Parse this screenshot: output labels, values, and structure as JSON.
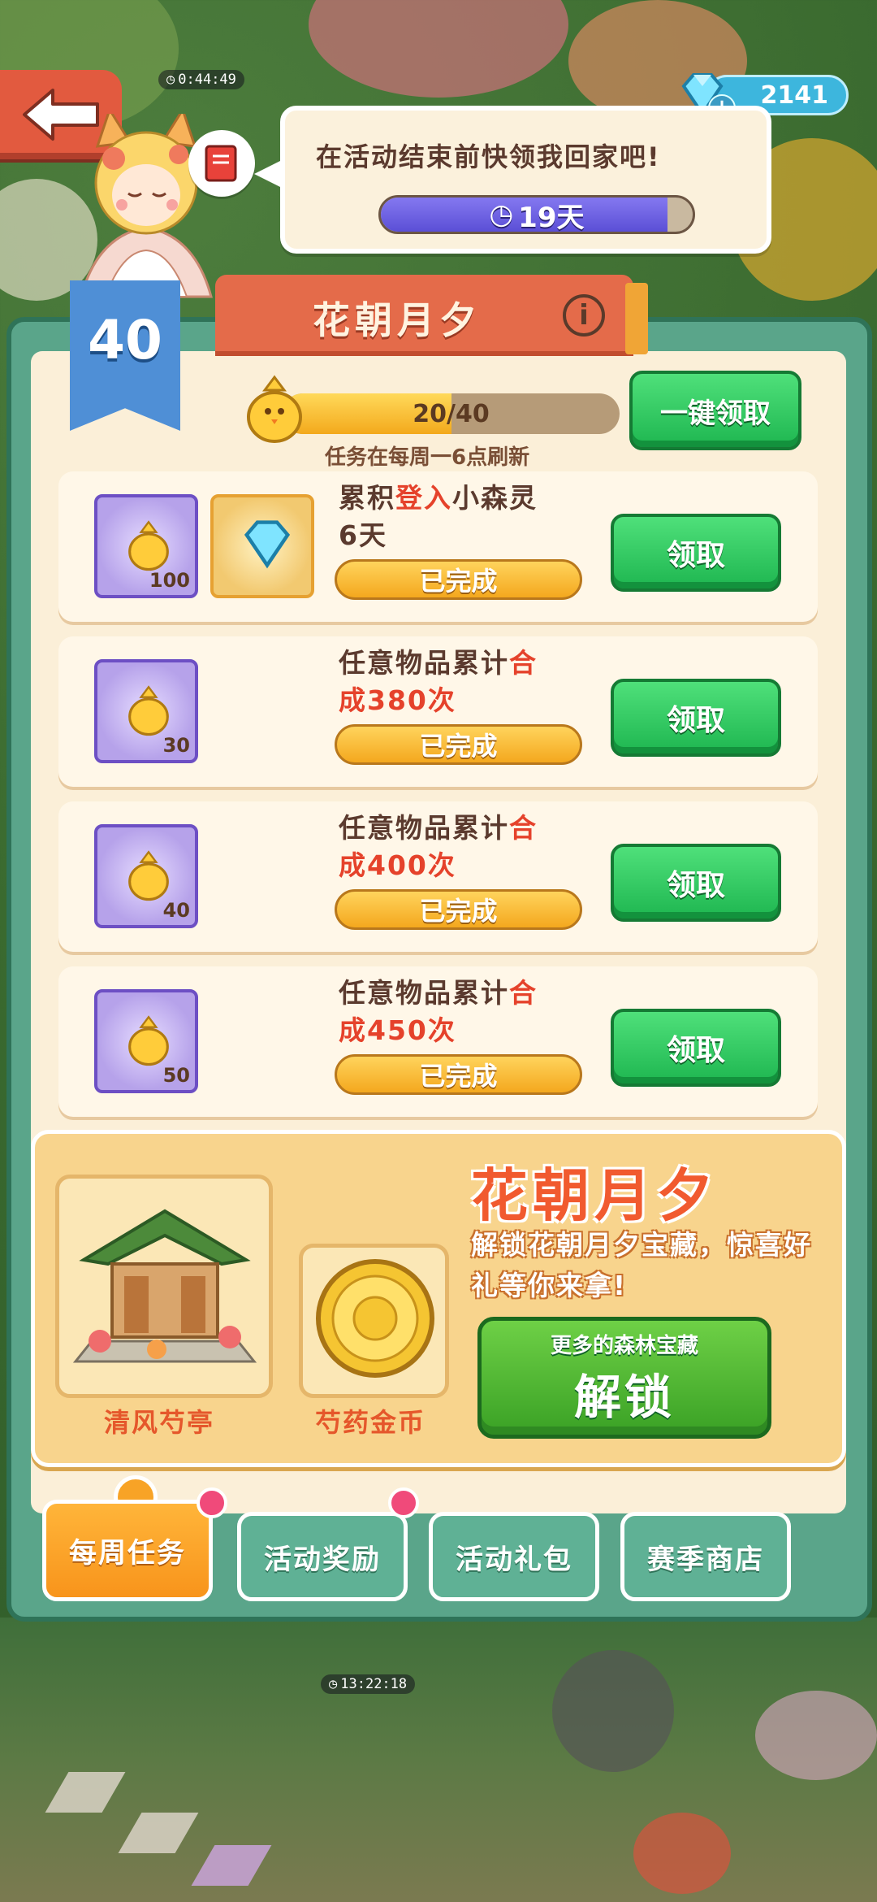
{
  "hud": {
    "top_timer": "0:44:49",
    "gems": "2141",
    "plus": "+"
  },
  "bubble": {
    "message": "在活动结束前快领我回家吧!",
    "countdown": "19天",
    "countdown_fraction": 0.92
  },
  "event": {
    "title": "花朝月夕",
    "level": "40",
    "progress_label": "20/40",
    "progress_fraction": 0.5,
    "refresh_note": "任务在每周一6点刷新",
    "claim_all_label": "一键领取"
  },
  "tasks": [
    {
      "desc_line1_a": "累积",
      "desc_line1_hl": "登入",
      "desc_line1_b": "小森灵",
      "desc_line2_hl": "",
      "desc_line2_b": "6天",
      "reward1_count": "100",
      "status": "已完成",
      "claim_label": "领取"
    },
    {
      "desc_line1_a": "任意物品累计",
      "desc_line1_hl": "合",
      "desc_line1_b": "",
      "desc_line2_hl": "成380次",
      "desc_line2_b": "",
      "reward1_count": "30",
      "status": "已完成",
      "claim_label": "领取"
    },
    {
      "desc_line1_a": "任意物品累计",
      "desc_line1_hl": "合",
      "desc_line1_b": "",
      "desc_line2_hl": "成400次",
      "desc_line2_b": "",
      "reward1_count": "40",
      "status": "已完成",
      "claim_label": "领取"
    },
    {
      "desc_line1_a": "任意物品累计",
      "desc_line1_hl": "合",
      "desc_line1_b": "",
      "desc_line2_hl": "成450次",
      "desc_line2_b": "",
      "reward1_count": "50",
      "status": "已完成",
      "claim_label": "领取"
    }
  ],
  "promo": {
    "title": "花朝月夕",
    "desc": "解锁花朝月夕宝藏，惊喜好礼等你来拿!",
    "item1": "清风芍亭",
    "item2": "芍药金币",
    "unlock_sub": "更多的森林宝藏",
    "unlock_main": "解锁"
  },
  "tabs": {
    "weekly": "每周任务",
    "rewards": "活动奖励",
    "gifts": "活动礼包",
    "shop": "赛季商店"
  },
  "scene": {
    "bottom_timer": "13:22:18"
  },
  "colors": {
    "panel_green": "#5aa58a",
    "claim_green": "#1eb650",
    "banner_red": "#e46b4a",
    "gold": "#f4a81e"
  },
  "icons": {
    "back": "back-arrow-icon",
    "gem": "diamond-icon",
    "clock": "clock-icon",
    "info": "info-icon",
    "book": "book-icon",
    "chick": "golden-chick-icon"
  }
}
